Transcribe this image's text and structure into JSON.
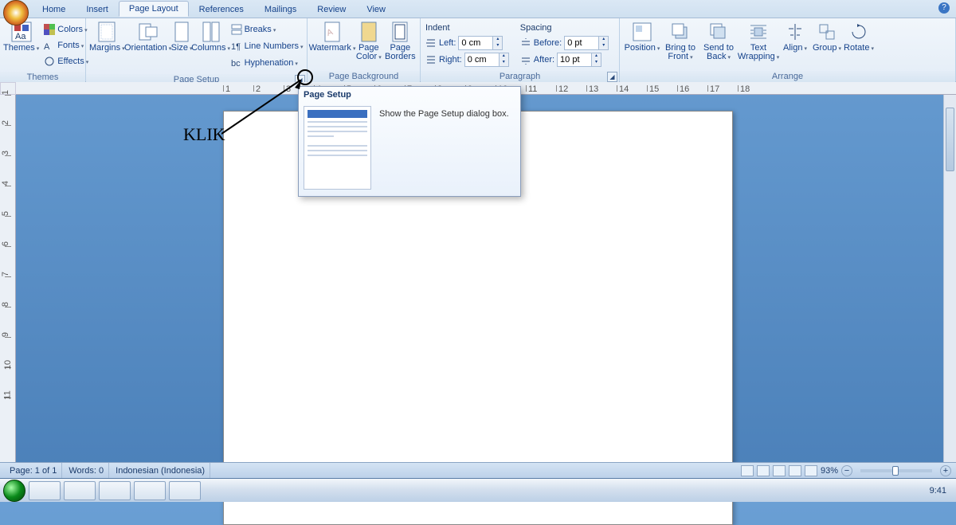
{
  "tabs": [
    "Home",
    "Insert",
    "Page Layout",
    "References",
    "Mailings",
    "Review",
    "View"
  ],
  "active_tab": "Page Layout",
  "groups": {
    "themes": {
      "label": "Themes",
      "main": "Themes",
      "colors": "Colors",
      "fonts": "Fonts",
      "effects": "Effects"
    },
    "page_setup": {
      "label": "Page Setup",
      "margins": "Margins",
      "orientation": "Orientation",
      "size": "Size",
      "columns": "Columns",
      "breaks": "Breaks",
      "line_numbers": "Line Numbers",
      "hyphenation": "Hyphenation"
    },
    "page_background": {
      "label": "Page Background",
      "watermark": "Watermark",
      "page_color": "Page Color",
      "page_borders": "Page Borders"
    },
    "paragraph": {
      "label": "Paragraph",
      "indent": "Indent",
      "spacing": "Spacing",
      "left": "Left:",
      "right": "Right:",
      "before": "Before:",
      "after": "After:",
      "left_val": "0 cm",
      "right_val": "0 cm",
      "before_val": "0 pt",
      "after_val": "10 pt"
    },
    "arrange": {
      "label": "Arrange",
      "position": "Position",
      "bring_front": "Bring to Front",
      "send_back": "Send to Back",
      "text_wrapping": "Text Wrapping",
      "align": "Align",
      "group": "Group",
      "rotate": "Rotate"
    }
  },
  "tooltip": {
    "title": "Page Setup",
    "desc": "Show the Page Setup dialog box."
  },
  "annotation": "KLIK",
  "ruler_marks": [
    "1",
    "2",
    "3",
    "4",
    "5",
    "6",
    "7",
    "8",
    "9",
    "10",
    "11",
    "12",
    "13",
    "14",
    "15",
    "16",
    "17",
    "18"
  ],
  "ruler_marks_v": [
    "1",
    "2",
    "3",
    "4",
    "5",
    "6",
    "7",
    "8",
    "9",
    "10",
    "11"
  ],
  "status": {
    "page": "Page: 1 of 1",
    "words": "Words: 0",
    "lang": "Indonesian (Indonesia)",
    "zoom": "93%"
  },
  "clock": "9:41"
}
